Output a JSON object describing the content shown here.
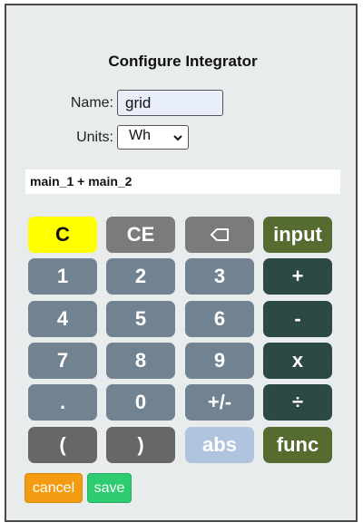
{
  "dialog": {
    "title": "Configure Integrator",
    "name_label": "Name:",
    "name_value": "grid",
    "units_label": "Units:",
    "units_value": "Wh",
    "expression": "main_1 + main_2"
  },
  "keypad": {
    "row1": [
      "C",
      "CE",
      "backspace-icon",
      "input"
    ],
    "row2": [
      "1",
      "2",
      "3",
      "+"
    ],
    "row3": [
      "4",
      "5",
      "6",
      "-"
    ],
    "row4": [
      "7",
      "8",
      "9",
      "x"
    ],
    "row5": [
      ".",
      "0",
      "+/-",
      "÷"
    ],
    "row6": [
      "(",
      ")",
      "abs",
      "func"
    ]
  },
  "actions": {
    "cancel_label": "cancel",
    "save_label": "save"
  },
  "colors": {
    "frame_bg": "#e8eced",
    "digit_key": "#718291",
    "operator_key": "#2c4945",
    "function_key": "#556b2f",
    "clear_key": "#ffff00",
    "cancel": "#f39c12",
    "save": "#2ecc71"
  }
}
